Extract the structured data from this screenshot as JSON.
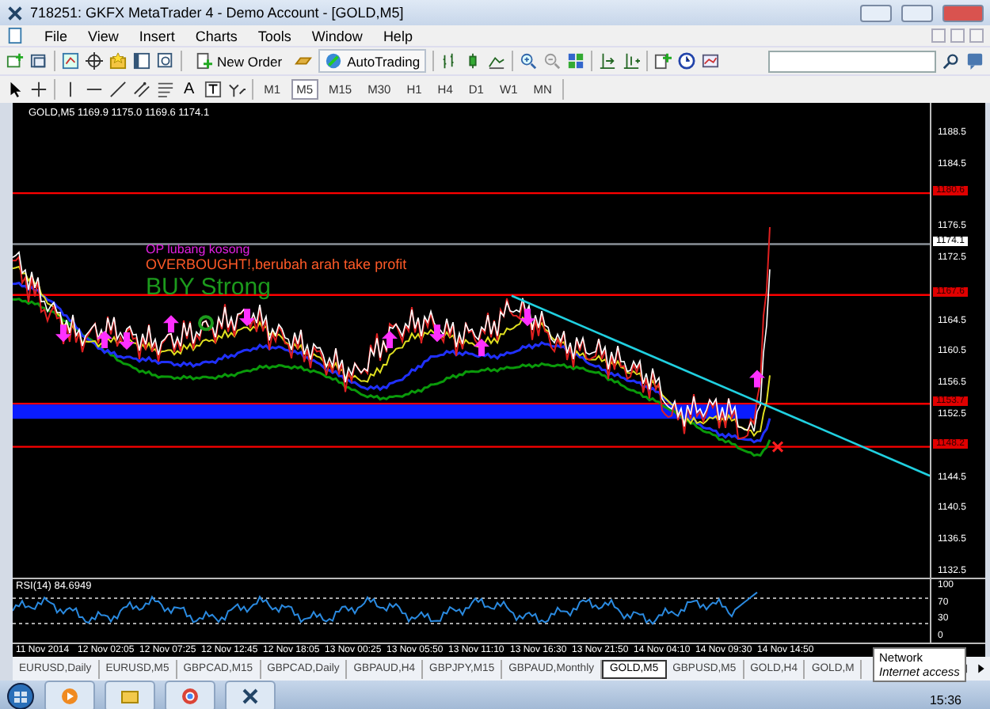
{
  "window": {
    "title": "718251: GKFX MetaTrader 4 - Demo Account - [GOLD,M5]"
  },
  "menu": [
    "File",
    "View",
    "Insert",
    "Charts",
    "Tools",
    "Window",
    "Help"
  ],
  "toolbar": {
    "new_order": "New Order",
    "auto_trading": "AutoTrading"
  },
  "drawing_tools": {
    "text_tool": "A"
  },
  "timeframes": [
    {
      "label": "M1",
      "selected": false
    },
    {
      "label": "M5",
      "selected": true
    },
    {
      "label": "M15",
      "selected": false
    },
    {
      "label": "M30",
      "selected": false
    },
    {
      "label": "H1",
      "selected": false
    },
    {
      "label": "H4",
      "selected": false
    },
    {
      "label": "D1",
      "selected": false
    },
    {
      "label": "W1",
      "selected": false
    },
    {
      "label": "MN",
      "selected": false
    }
  ],
  "chart": {
    "symbol_info": "GOLD,M5  1169.9 1175.0 1169.6 1174.1",
    "notes": [
      {
        "text": "OP lubang kosong",
        "kind": "info"
      },
      {
        "text": "OVERBOUGHT!,berubah arah take profit",
        "kind": "warning"
      },
      {
        "text": "BUY Strong",
        "kind": "signal"
      }
    ],
    "price_ticks": [
      "1188.5",
      "1184.5",
      "1176.5",
      "1172.5",
      "1164.5",
      "1160.5",
      "1156.5",
      "1152.5",
      "1144.5",
      "1140.5",
      "1136.5",
      "1132.5"
    ],
    "levels": [
      {
        "label": "1180.6",
        "kind": "line"
      },
      {
        "label": "1174.1",
        "kind": "bid"
      },
      {
        "label": "1167.6",
        "kind": "line"
      },
      {
        "label": "1153.7",
        "kind": "line"
      },
      {
        "label": "1148.2",
        "kind": "line"
      }
    ]
  },
  "rsi": {
    "label": "RSI(14) 84.6949",
    "ticks": [
      "100",
      "70",
      "30",
      "0"
    ]
  },
  "time_axis": [
    "11 Nov 2014",
    "12 Nov 02:05",
    "12 Nov 07:25",
    "12 Nov 12:45",
    "12 Nov 18:05",
    "13 Nov 00:25",
    "13 Nov 05:50",
    "13 Nov 11:10",
    "13 Nov 16:30",
    "13 Nov 21:50",
    "14 Nov 04:10",
    "14 Nov 09:30",
    "14 Nov 14:50"
  ],
  "tabs": [
    {
      "label": "EURUSD,Daily",
      "selected": false
    },
    {
      "label": "EURUSD,M5",
      "selected": false
    },
    {
      "label": "GBPCAD,M15",
      "selected": false
    },
    {
      "label": "GBPCAD,Daily",
      "selected": false
    },
    {
      "label": "GBPAUD,H4",
      "selected": false
    },
    {
      "label": "GBPJPY,M15",
      "selected": false
    },
    {
      "label": "GBPAUD,Monthly",
      "selected": false
    },
    {
      "label": "GOLD,M5",
      "selected": true
    },
    {
      "label": "GBPUSD,M5",
      "selected": false
    },
    {
      "label": "GOLD,H4",
      "selected": false
    },
    {
      "label": "GOLD,M",
      "selected": false
    }
  ],
  "tooltip": {
    "title": "Network",
    "subtitle": "Internet access"
  },
  "taskbar": {
    "clock": "15:36"
  }
}
